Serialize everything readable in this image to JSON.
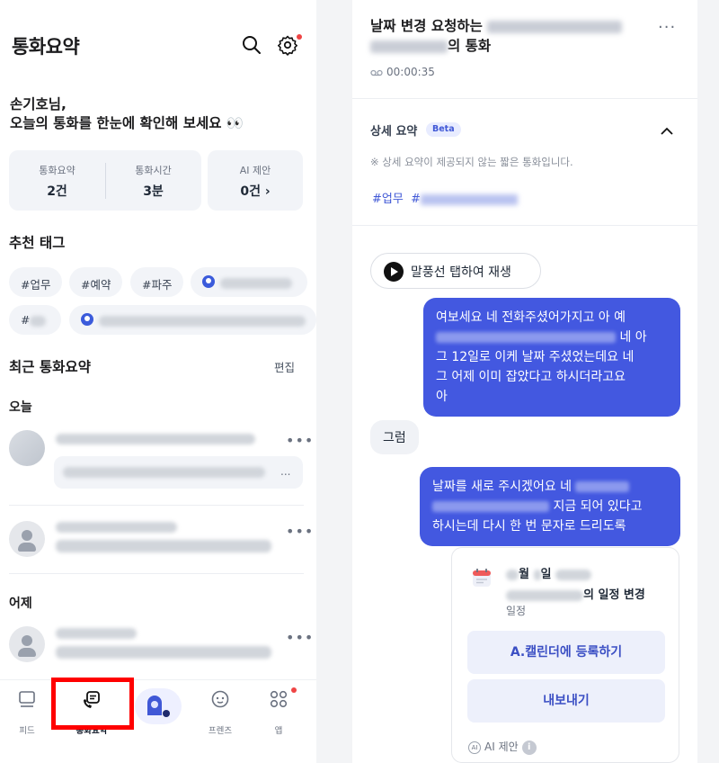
{
  "left": {
    "header": {
      "title": "통화요약",
      "search_icon": "search-icon",
      "settings_icon": "gear-icon"
    },
    "greeting": {
      "line1": "손기호님,",
      "line2": "오늘의 통화를 한눈에 확인해 보세요 👀"
    },
    "stats": [
      {
        "label": "통화요약",
        "value": "2건"
      },
      {
        "label": "통화시간",
        "value": "3분"
      },
      {
        "label": "AI 제안",
        "value": "0건 ›"
      }
    ],
    "recommended_tags": {
      "title": "추천 태그",
      "tags": [
        "#업무",
        "#예약",
        "#파주",
        "#"
      ]
    },
    "recent": {
      "title": "최근 통화요약",
      "edit_label": "편집",
      "today_label": "오늘",
      "yesterday_label": "어제",
      "snippet_ellipsis": "..."
    },
    "nav": {
      "items": [
        {
          "label": "피드",
          "icon": "feed-icon"
        },
        {
          "label": "통화요약",
          "icon": "call-summary-icon"
        },
        {
          "label": "",
          "icon": "assistant-icon"
        },
        {
          "label": "프렌즈",
          "icon": "friends-icon"
        },
        {
          "label": "앱",
          "icon": "apps-icon"
        }
      ]
    }
  },
  "right": {
    "call": {
      "title_prefix": "날짜 변경 요청하는",
      "title_suffix": "의 통화",
      "duration": "00:00:35",
      "more": "···"
    },
    "summary": {
      "title": "상세 요약",
      "badge": "Beta",
      "note": "※ 상세 요약이 제공되지 않는 짧은 통화입니다.",
      "hashtag1": "#업무",
      "hashtag2": "#"
    },
    "play_label": "말풍선 탭하여 재생",
    "messages": {
      "m1_line1": "여보세요 네 전화주셨어가지고 아 예",
      "m1_line2_end": "네 아",
      "m1_line3": "그 12일로 이케 날짜 주셨었는데요 네",
      "m1_line4": "그 어제 이미 잡았다고 하시더라고요",
      "m1_line5": "아",
      "m2": "그럼",
      "m3_line1": "날짜를 새로 주시겠어요 네",
      "m3_line2_end": "지금 되어 있다고",
      "m3_line3": "하시는데 다시 한 번 문자로 드리도록"
    },
    "event": {
      "month_suffix": "월",
      "day_suffix": "일",
      "title_suffix": "의 일정 변경",
      "type": "일정",
      "register_button": "A.캘린더에 등록하기",
      "export_button": "내보내기",
      "ai_note": "AI 제안",
      "ai_badge": "AI",
      "info": "i"
    }
  }
}
